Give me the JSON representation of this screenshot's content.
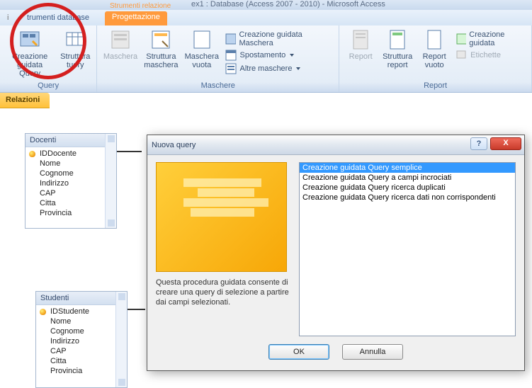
{
  "window": {
    "title": "ex1 : Database (Access 2007 - 2010) - Microsoft Access"
  },
  "tabs": {
    "partial": "i",
    "database": "trumenti database",
    "contextGroup": "Strumenti relazione",
    "active": "Progettazione"
  },
  "ribbon": {
    "query": {
      "btn1_l1": "Creazione",
      "btn1_l2": "guidata Query",
      "btn2_l1": "Struttura",
      "btn2_l2": "tuery",
      "group": "Query"
    },
    "maschere": {
      "btn1": "Maschera",
      "btn2_l1": "Struttura",
      "btn2_l2": "maschera",
      "btn3_l1": "Maschera",
      "btn3_l2": "vuota",
      "s1": "Creazione guidata Maschera",
      "s2": "Spostamento",
      "s3": "Altre maschere",
      "group": "Maschere"
    },
    "report": {
      "btn1": "Report",
      "btn2_l1": "Struttura",
      "btn2_l2": "report",
      "btn3_l1": "Report",
      "btn3_l2": "vuoto",
      "s1": "Creazione guidata",
      "s2": "Etichette",
      "group": "Report"
    }
  },
  "reltab": "Relazioni",
  "tables": {
    "docenti": {
      "title": "Docenti",
      "fields": [
        "IDDocente",
        "Nome",
        "Cognome",
        "Indirizzo",
        "CAP",
        "Citta",
        "Provincia"
      ]
    },
    "studenti": {
      "title": "Studenti",
      "fields": [
        "IDStudente",
        "Nome",
        "Cognome",
        "Indirizzo",
        "CAP",
        "Citta",
        "Provincia"
      ]
    }
  },
  "dialog": {
    "title": "Nuova query",
    "options": [
      "Creazione guidata Query semplice",
      "Creazione guidata Query a campi incrociati",
      "Creazione guidata Query ricerca duplicati",
      "Creazione guidata Query ricerca dati non corrispondenti"
    ],
    "description": "Questa procedura guidata consente di creare una query di selezione a partire dai campi selezionati.",
    "ok": "OK",
    "cancel": "Annulla",
    "help": "?",
    "close": "X"
  }
}
